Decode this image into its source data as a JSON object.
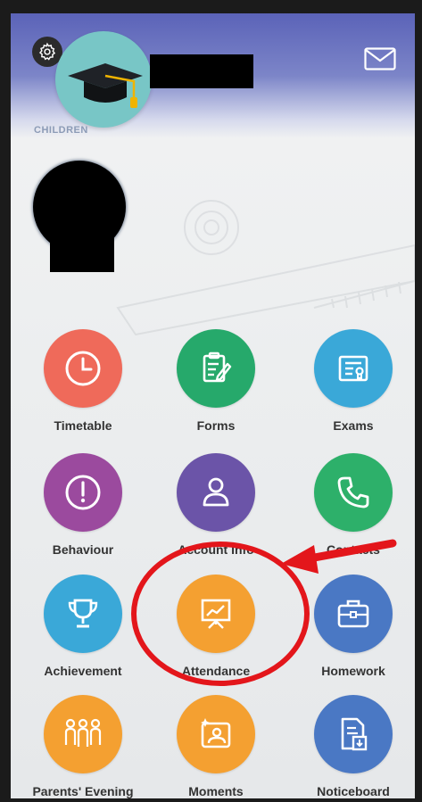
{
  "header": {
    "children_label": "CHILDREN"
  },
  "colors": {
    "header": "#6b73bf",
    "timetable": "#ef6a5a",
    "forms": "#26a96b",
    "exams": "#3aa8d8",
    "behaviour": "#9b4a9e",
    "account_info": "#6b54a8",
    "contacts": "#2db06a",
    "achievement": "#3aa8d8",
    "attendance": "#f4a031",
    "homework": "#4a78c4",
    "parents_evening": "#f4a031",
    "moments": "#f4a031",
    "noticeboard": "#4a78c4",
    "annotation": "#e3161b"
  },
  "menu": [
    {
      "label": "Timetable",
      "icon": "clock-icon",
      "color": "#ef6a5a"
    },
    {
      "label": "Forms",
      "icon": "form-edit-icon",
      "color": "#26a96b"
    },
    {
      "label": "Exams",
      "icon": "certificate-icon",
      "color": "#3aa8d8"
    },
    {
      "label": "Behaviour",
      "icon": "exclamation-icon",
      "color": "#9b4a9e"
    },
    {
      "label": "Account Info",
      "icon": "user-icon",
      "color": "#6b54a8"
    },
    {
      "label": "Contacts",
      "icon": "phone-icon",
      "color": "#2db06a"
    },
    {
      "label": "Achievement",
      "icon": "trophy-icon",
      "color": "#3aa8d8"
    },
    {
      "label": "Attendance",
      "icon": "presentation-chart-icon",
      "color": "#f4a031"
    },
    {
      "label": "Homework",
      "icon": "briefcase-icon",
      "color": "#4a78c4"
    },
    {
      "label": "Parents' Evening",
      "icon": "people-icon",
      "color": "#f4a031"
    },
    {
      "label": "Moments",
      "icon": "photo-frame-icon",
      "color": "#f4a031"
    },
    {
      "label": "Noticeboard",
      "icon": "document-download-icon",
      "color": "#4a78c4"
    }
  ]
}
